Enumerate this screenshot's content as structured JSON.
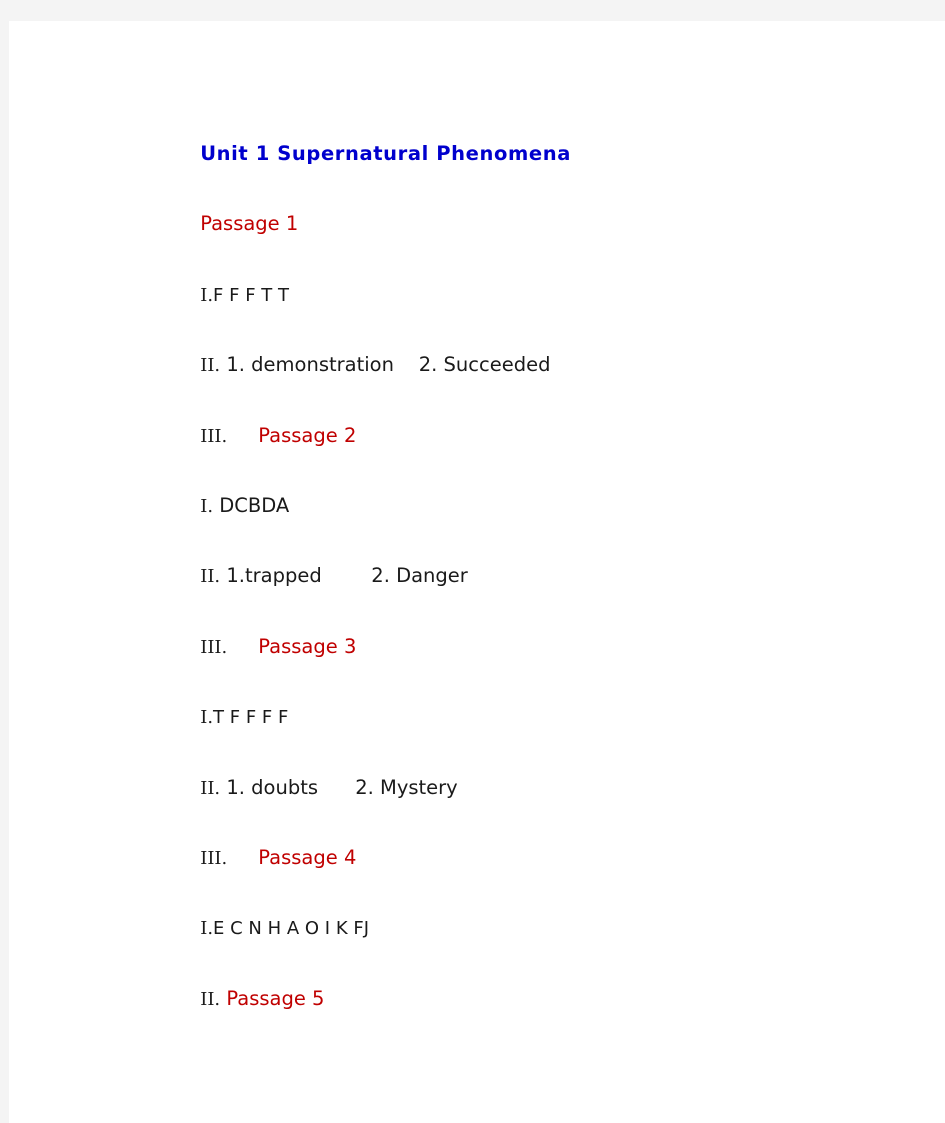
{
  "document": {
    "title": "Unit 1 Supernatural Phenomena",
    "colors": {
      "title_blue": "#0000cd",
      "passage_red": "#c00000",
      "body_text": "#1a1a1a",
      "page_background": "#ffffff",
      "canvas_background": "#f4f4f4"
    },
    "lines": [
      {
        "id": "line-title",
        "kind": "heading",
        "text": "Unit 1 Supernatural Phenomena"
      },
      {
        "id": "line-passage-1",
        "kind": "passage-heading",
        "text": "Passage 1"
      },
      {
        "id": "line-p1-i",
        "kind": "answer",
        "numeral": "I.",
        "text": "F F F T T"
      },
      {
        "id": "line-p1-ii",
        "kind": "answer",
        "numeral": "II.",
        "text": " 1. demonstration    2. Succeeded"
      },
      {
        "id": "line-p1-iii",
        "kind": "answer-with-passage",
        "numeral": "III.",
        "text": "     ",
        "passage": "Passage 2"
      },
      {
        "id": "line-p2-i",
        "kind": "answer",
        "numeral": "I.",
        "text": " DCBDA"
      },
      {
        "id": "line-p2-ii",
        "kind": "answer",
        "numeral": "II.",
        "text": " 1.trapped        2. Danger"
      },
      {
        "id": "line-p2-iii",
        "kind": "answer-with-passage",
        "numeral": "III.",
        "text": "     ",
        "passage": "Passage 3"
      },
      {
        "id": "line-p3-i",
        "kind": "answer",
        "numeral": "I.",
        "text": "T F F F F"
      },
      {
        "id": "line-p3-ii",
        "kind": "answer",
        "numeral": "II.",
        "text": " 1. doubts      2. Mystery"
      },
      {
        "id": "line-p3-iii",
        "kind": "answer-with-passage",
        "numeral": "III.",
        "text": "     ",
        "passage": "Passage 4"
      },
      {
        "id": "line-p4-i",
        "kind": "answer",
        "numeral": "I.",
        "text": "E C N H A O I K FJ"
      },
      {
        "id": "line-p4-ii",
        "kind": "answer-with-passage",
        "numeral": "II.",
        "text": " ",
        "passage": "Passage 5"
      }
    ]
  }
}
